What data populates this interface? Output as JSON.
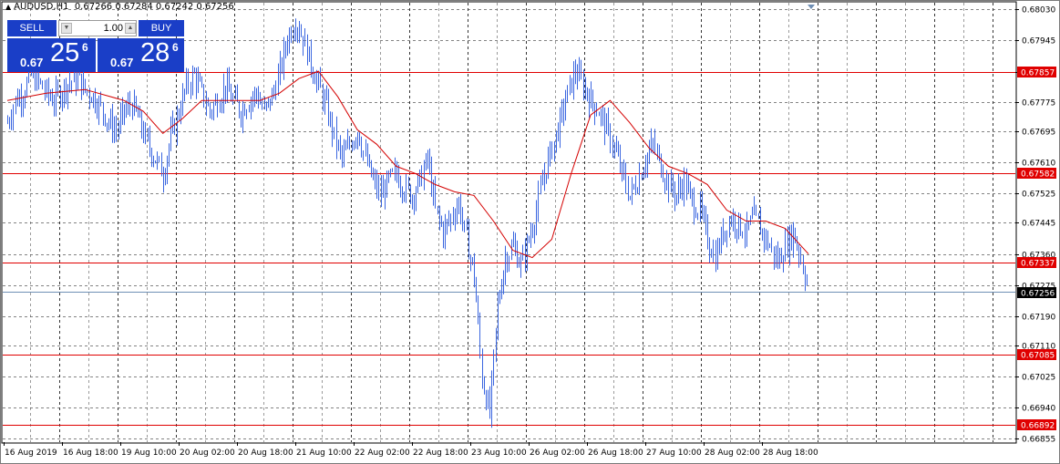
{
  "header": {
    "symbol": "AUDUSD,H1",
    "ohlc": "0.67266 0.67284 0.67242 0.67256"
  },
  "one_click": {
    "sell_label": "SELL",
    "buy_label": "BUY",
    "lot": "1.00",
    "sell_small": "0.67",
    "sell_big": "25",
    "sell_sup": "6",
    "buy_small": "0.67",
    "buy_big": "28",
    "buy_sup": "6"
  },
  "colors": {
    "candle": "#3a66e0",
    "ma": "#d40000",
    "level_line": "#e00000",
    "level_tag_bg": "#e00000",
    "grid": "#1e1e1e",
    "current_price_line": "#6f8fb5",
    "current_price_tag_bg": "#000000",
    "trading_panel": "#1a3ec7"
  },
  "chart_data": {
    "type": "candlestick",
    "symbol": "AUDUSD",
    "timeframe": "H1",
    "ylim": [
      0.66855,
      0.6803
    ],
    "y_ticks": [
      "0.68030",
      "0.67945",
      "0.67857",
      "0.67775",
      "0.67695",
      "0.67610",
      "0.67525",
      "0.67445",
      "0.67360",
      "0.67275",
      "0.67190",
      "0.67110",
      "0.67025",
      "0.66940",
      "0.66855"
    ],
    "x_tick_labels": [
      "16 Aug 2019",
      "16 Aug 18:00",
      "19 Aug 10:00",
      "20 Aug 02:00",
      "20 Aug 18:00",
      "21 Aug 10:00",
      "22 Aug 02:00",
      "22 Aug 18:00",
      "23 Aug 10:00",
      "26 Aug 02:00",
      "26 Aug 18:00",
      "27 Aug 10:00",
      "28 Aug 02:00",
      "28 Aug 18:00"
    ],
    "grid": true,
    "horizontal_levels": [
      "0.67857",
      "0.67582",
      "0.67337",
      "0.67085",
      "0.66892"
    ],
    "current_price": "0.67256",
    "indicator": "moving average",
    "path_points": [
      [
        0,
        0.6772
      ],
      [
        4,
        0.6778
      ],
      [
        8,
        0.678
      ],
      [
        12,
        0.6785
      ],
      [
        16,
        0.6783
      ],
      [
        20,
        0.678
      ],
      [
        24,
        0.6778
      ],
      [
        28,
        0.6781
      ],
      [
        32,
        0.6783
      ],
      [
        36,
        0.6784
      ],
      [
        40,
        0.6781
      ],
      [
        44,
        0.6779
      ],
      [
        48,
        0.6776
      ],
      [
        52,
        0.6772
      ],
      [
        56,
        0.677
      ],
      [
        60,
        0.6775
      ],
      [
        64,
        0.6777
      ],
      [
        68,
        0.6772
      ],
      [
        72,
        0.6766
      ],
      [
        76,
        0.6762
      ],
      [
        80,
        0.6758
      ],
      [
        84,
        0.6768
      ],
      [
        88,
        0.6775
      ],
      [
        92,
        0.6782
      ],
      [
        96,
        0.6785
      ],
      [
        100,
        0.678
      ],
      [
        104,
        0.6775
      ],
      [
        108,
        0.6778
      ],
      [
        112,
        0.6782
      ],
      [
        116,
        0.6778
      ],
      [
        120,
        0.6775
      ],
      [
        124,
        0.6778
      ],
      [
        128,
        0.678
      ],
      [
        132,
        0.6775
      ],
      [
        136,
        0.6779
      ],
      [
        140,
        0.6786
      ],
      [
        144,
        0.6795
      ],
      [
        148,
        0.68
      ],
      [
        152,
        0.6795
      ],
      [
        156,
        0.6788
      ],
      [
        160,
        0.6782
      ],
      [
        164,
        0.6776
      ],
      [
        168,
        0.6768
      ],
      [
        172,
        0.6762
      ],
      [
        176,
        0.6766
      ],
      [
        180,
        0.677
      ],
      [
        184,
        0.6762
      ],
      [
        188,
        0.6756
      ],
      [
        192,
        0.6752
      ],
      [
        196,
        0.6756
      ],
      [
        200,
        0.6758
      ],
      [
        204,
        0.6754
      ],
      [
        208,
        0.6752
      ],
      [
        212,
        0.6756
      ],
      [
        216,
        0.6762
      ],
      [
        220,
        0.6748
      ],
      [
        224,
        0.6742
      ],
      [
        228,
        0.6746
      ],
      [
        232,
        0.675
      ],
      [
        236,
        0.674
      ],
      [
        240,
        0.673
      ],
      [
        244,
        0.6702
      ],
      [
        248,
        0.6692
      ],
      [
        252,
        0.6722
      ],
      [
        256,
        0.6735
      ],
      [
        260,
        0.6738
      ],
      [
        264,
        0.6733
      ],
      [
        268,
        0.674
      ],
      [
        272,
        0.6748
      ],
      [
        276,
        0.6758
      ],
      [
        280,
        0.6765
      ],
      [
        284,
        0.6772
      ],
      [
        288,
        0.678
      ],
      [
        292,
        0.6786
      ],
      [
        296,
        0.6782
      ],
      [
        300,
        0.6778
      ],
      [
        304,
        0.6775
      ],
      [
        308,
        0.677
      ],
      [
        312,
        0.6765
      ],
      [
        316,
        0.6758
      ],
      [
        320,
        0.6752
      ],
      [
        324,
        0.6756
      ],
      [
        328,
        0.6762
      ],
      [
        332,
        0.6766
      ],
      [
        336,
        0.676
      ],
      [
        340,
        0.6755
      ],
      [
        344,
        0.6752
      ],
      [
        348,
        0.6756
      ],
      [
        352,
        0.675
      ],
      [
        356,
        0.6748
      ],
      [
        360,
        0.674
      ],
      [
        364,
        0.6735
      ],
      [
        368,
        0.6742
      ],
      [
        372,
        0.6746
      ],
      [
        376,
        0.6744
      ],
      [
        380,
        0.6742
      ],
      [
        384,
        0.6746
      ],
      [
        388,
        0.6742
      ],
      [
        392,
        0.6738
      ],
      [
        396,
        0.6734
      ],
      [
        400,
        0.6738
      ],
      [
        404,
        0.6742
      ],
      [
        408,
        0.6735
      ],
      [
        412,
        0.6726
      ]
    ],
    "ma_points": [
      [
        0,
        0.6778
      ],
      [
        20,
        0.678
      ],
      [
        40,
        0.6781
      ],
      [
        60,
        0.6778
      ],
      [
        70,
        0.6775
      ],
      [
        80,
        0.6769
      ],
      [
        90,
        0.6773
      ],
      [
        100,
        0.6778
      ],
      [
        120,
        0.6778
      ],
      [
        130,
        0.6778
      ],
      [
        140,
        0.678
      ],
      [
        150,
        0.6784
      ],
      [
        160,
        0.6786
      ],
      [
        170,
        0.6779
      ],
      [
        180,
        0.677
      ],
      [
        190,
        0.6766
      ],
      [
        200,
        0.676
      ],
      [
        210,
        0.6758
      ],
      [
        220,
        0.6755
      ],
      [
        230,
        0.6753
      ],
      [
        240,
        0.6752
      ],
      [
        250,
        0.6745
      ],
      [
        260,
        0.6737
      ],
      [
        270,
        0.6735
      ],
      [
        280,
        0.674
      ],
      [
        290,
        0.6758
      ],
      [
        300,
        0.6774
      ],
      [
        310,
        0.6778
      ],
      [
        320,
        0.6772
      ],
      [
        330,
        0.6765
      ],
      [
        340,
        0.676
      ],
      [
        350,
        0.6758
      ],
      [
        360,
        0.6755
      ],
      [
        370,
        0.6748
      ],
      [
        380,
        0.6745
      ],
      [
        390,
        0.6745
      ],
      [
        400,
        0.6743
      ],
      [
        412,
        0.6736
      ]
    ]
  }
}
